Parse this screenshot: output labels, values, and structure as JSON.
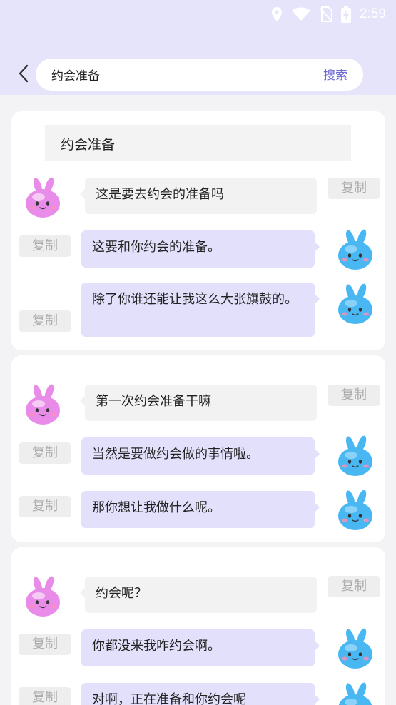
{
  "status_bar": {
    "time": "2:59"
  },
  "search": {
    "query": "约会准备",
    "button_label": "搜索"
  },
  "copy_label": "复制",
  "cards": [
    {
      "title": "约会准备",
      "messages": [
        {
          "from": "bot",
          "text": "这是要去约会的准备吗"
        },
        {
          "from": "user",
          "text": "这要和你约会的准备。"
        },
        {
          "from": "user",
          "text": "除了你谁还能让我这么大张旗鼓的。"
        }
      ]
    },
    {
      "messages": [
        {
          "from": "bot",
          "text": "第一次约会准备干嘛"
        },
        {
          "from": "user",
          "text": "当然是要做约会做的事情啦。"
        },
        {
          "from": "user",
          "text": "那你想让我做什么呢。"
        }
      ]
    },
    {
      "messages": [
        {
          "from": "bot",
          "text": "约会呢？"
        },
        {
          "from": "user",
          "text": "你都没来我咋约会啊。"
        },
        {
          "from": "user",
          "text": "对啊，正在准备和你约会呢"
        }
      ]
    }
  ],
  "colors": {
    "header_bg": "#e6e4fa",
    "accent": "#6e6ad0",
    "bot_bubble": "#f2f2f2",
    "user_bubble": "#e3e0fb",
    "bot_avatar": "#e98be8",
    "user_avatar": "#49b7f2"
  }
}
